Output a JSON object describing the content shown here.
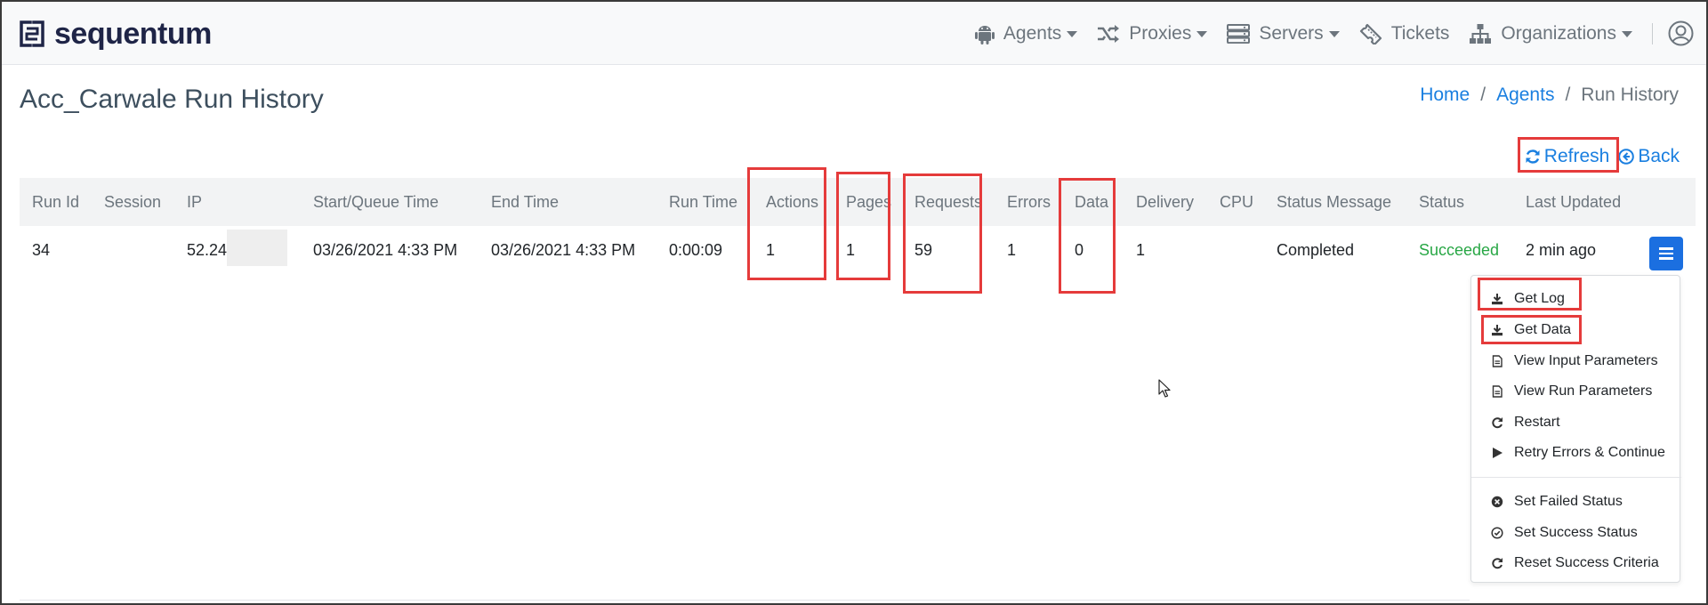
{
  "brand": {
    "name": "sequentum",
    "color": "#1f2547"
  },
  "nav": {
    "agents": "Agents",
    "proxies": "Proxies",
    "servers": "Servers",
    "tickets": "Tickets",
    "organizations": "Organizations"
  },
  "page": {
    "title": "Acc_Carwale Run History"
  },
  "breadcrumb": {
    "home": "Home",
    "sep": "/",
    "agents": "Agents",
    "current": "Run History"
  },
  "toolbar": {
    "refresh": "Refresh",
    "back": "Back"
  },
  "table": {
    "headers": [
      "Run Id",
      "Session",
      "IP",
      "Start/Queue Time",
      "End Time",
      "Run Time",
      "Actions",
      "Pages",
      "Requests",
      "Errors",
      "Data",
      "Delivery",
      "CPU",
      "Status Message",
      "Status",
      "Last Updated"
    ],
    "row": {
      "run_id": "34",
      "session": "",
      "ip": "52.247",
      "start_time": "03/26/2021 4:33 PM",
      "end_time": "03/26/2021 4:33 PM",
      "run_time": "0:00:09",
      "actions": "1",
      "pages": "1",
      "requests": "59",
      "errors": "1",
      "data": "0",
      "delivery": "1",
      "cpu": "",
      "status_message": "Completed",
      "status": "Succeeded",
      "last_updated": "2 min ago"
    }
  },
  "menu": {
    "items": [
      "Get Log",
      "Get Data",
      "View Input Parameters",
      "View Run Parameters",
      "Restart",
      "Retry Errors & Continue",
      "Set Failed Status",
      "Set Success Status",
      "Reset Success Criteria"
    ]
  },
  "colors": {
    "accent": "#1a7fe0",
    "success": "#28a745",
    "highlight": "#e53b3b",
    "menu_button": "#1b6fe0"
  },
  "icons": [
    "android-icon",
    "shuffle-icon",
    "server-icon",
    "ticket-icon",
    "sitemap-icon",
    "user-circle-icon",
    "refresh-icon",
    "back-circle-icon",
    "hamburger-icon",
    "download-icon",
    "file-icon",
    "restart-icon",
    "play-icon",
    "times-circle-icon",
    "check-circle-icon"
  ]
}
